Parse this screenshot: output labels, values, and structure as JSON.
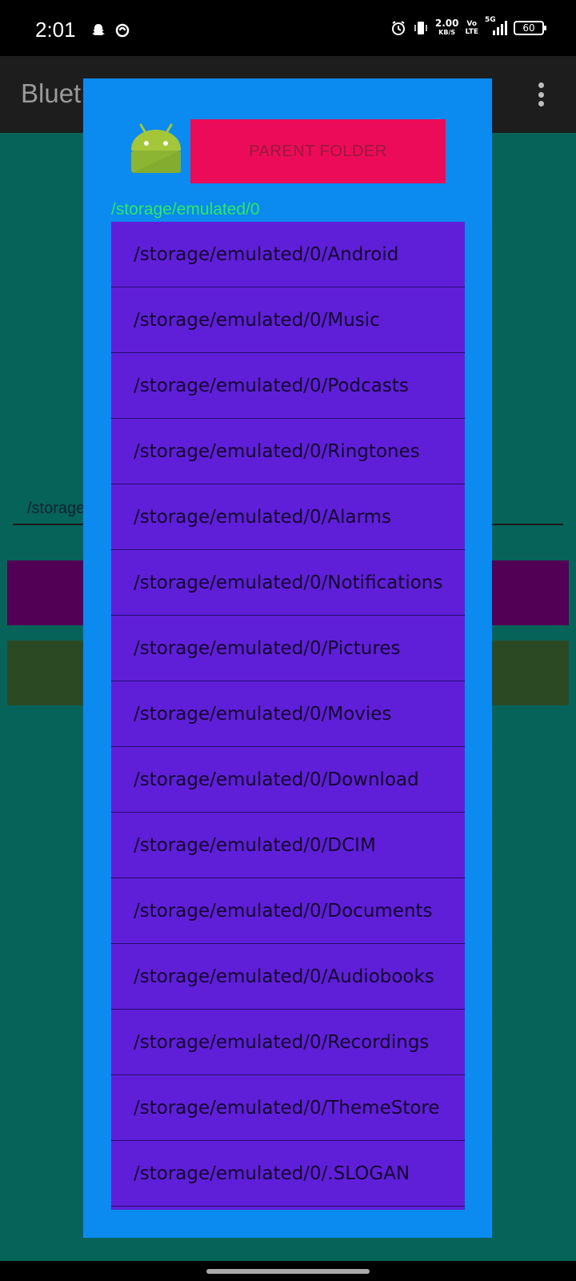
{
  "status_bar": {
    "time": "2:01",
    "net_speed": "2.00",
    "net_unit": "KB/S",
    "volte_top": "Vo",
    "volte_bottom": "LTE",
    "network": "5G",
    "battery": "60",
    "icons": [
      "snapchat-icon",
      "app-notification-icon",
      "alarm-icon",
      "vibrate-icon",
      "signal-icon"
    ]
  },
  "app": {
    "title": "Bluet",
    "path_field": "/storage"
  },
  "dialog": {
    "parent_button": "PARENT FOLDER",
    "current_path": "/storage/emulated/0",
    "items": [
      "/storage/emulated/0/Android",
      "/storage/emulated/0/Music",
      "/storage/emulated/0/Podcasts",
      "/storage/emulated/0/Ringtones",
      "/storage/emulated/0/Alarms",
      "/storage/emulated/0/Notifications",
      "/storage/emulated/0/Pictures",
      "/storage/emulated/0/Movies",
      "/storage/emulated/0/Download",
      "/storage/emulated/0/DCIM",
      "/storage/emulated/0/Documents",
      "/storage/emulated/0/Audiobooks",
      "/storage/emulated/0/Recordings",
      "/storage/emulated/0/ThemeStore",
      "/storage/emulated/0/.SLOGAN"
    ]
  },
  "colors": {
    "dialog_bg": "#0b8af0",
    "list_bg": "#5f1fd8",
    "parent_button_bg": "#ec0b58",
    "path_text": "#2ee860",
    "app_bg": "#06635a"
  }
}
